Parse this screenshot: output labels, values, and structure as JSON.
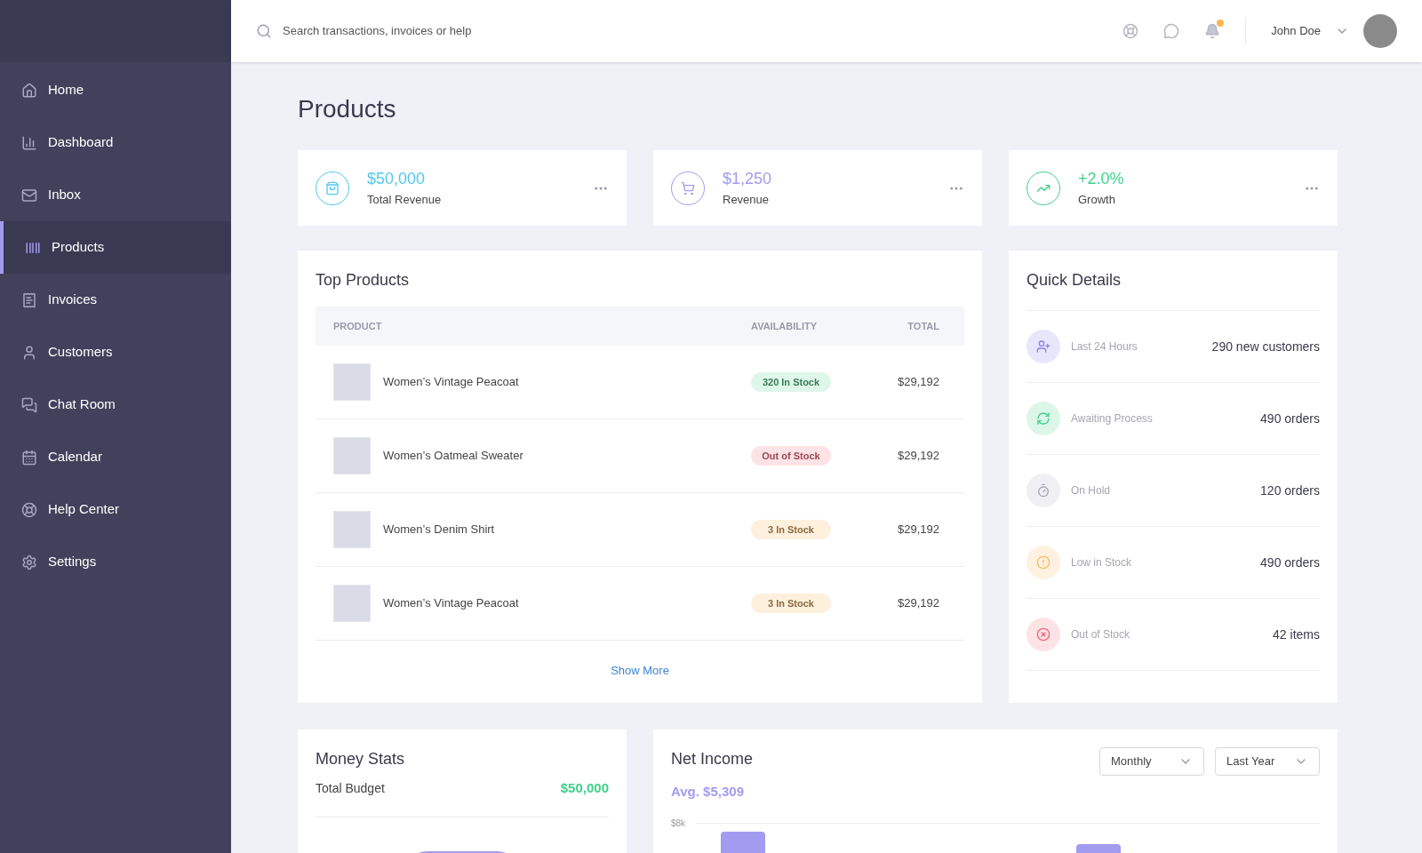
{
  "sidebar": {
    "items": [
      {
        "label": "Home",
        "kind": "home",
        "selected": false
      },
      {
        "label": "Dashboard",
        "kind": "chart",
        "selected": false
      },
      {
        "label": "Inbox",
        "kind": "mail",
        "selected": false
      },
      {
        "label": "Products",
        "kind": "barcode",
        "selected": true
      },
      {
        "label": "Invoices",
        "kind": "receipt",
        "selected": false
      },
      {
        "label": "Customers",
        "kind": "user",
        "selected": false
      },
      {
        "label": "Chat Room",
        "kind": "chat",
        "selected": false
      },
      {
        "label": "Calendar",
        "kind": "calendar",
        "selected": false
      },
      {
        "label": "Help Center",
        "kind": "help",
        "selected": false
      },
      {
        "label": "Settings",
        "kind": "gear",
        "selected": false
      }
    ]
  },
  "header": {
    "search": {
      "placeholder": "Search transactions, invoices or help"
    },
    "notification_dot": true,
    "user": {
      "name": "John Doe"
    }
  },
  "page_title": "Products",
  "stats": [
    {
      "value": "$50,000",
      "label": "Total Revenue",
      "kind": "bag",
      "color": "#4fc9ef"
    },
    {
      "value": "$1,250",
      "label": "Revenue",
      "kind": "cart",
      "color": "#a29bef"
    },
    {
      "value": "+2.0%",
      "label": "Growth",
      "kind": "trend",
      "color": "#3fd18c"
    }
  ],
  "top_products": {
    "title": "Top Products",
    "columns": [
      "PRODUCT",
      "AVAILABILITY",
      "TOTAL"
    ],
    "rows": [
      {
        "name": "Women’s Vintage Peacoat",
        "availability": "320 In Stock",
        "kind": "in",
        "total": "$29,192"
      },
      {
        "name": "Women’s Oatmeal Sweater",
        "availability": "Out of Stock",
        "kind": "out",
        "total": "$29,192"
      },
      {
        "name": "Women’s Denim Shirt",
        "availability": "3 In Stock",
        "kind": "low",
        "total": "$29,192"
      },
      {
        "name": "Women’s Vintage Peacoat",
        "availability": "3 In Stock",
        "kind": "low",
        "total": "$29,192"
      }
    ],
    "show_more": "Show More"
  },
  "quick_details": {
    "title": "Quick Details",
    "items": [
      {
        "label": "Last 24 Hours",
        "value": "290 new customers",
        "kind": "customers"
      },
      {
        "label": "Awaiting Process",
        "value": "490 orders",
        "kind": "process"
      },
      {
        "label": "On Hold",
        "value": "120 orders",
        "kind": "hold"
      },
      {
        "label": "Low in Stock",
        "value": "490 orders",
        "kind": "low"
      },
      {
        "label": "Out of Stock",
        "value": "42 items",
        "kind": "out"
      }
    ]
  },
  "money_stats": {
    "title": "Money Stats",
    "budget_label": "Total Budget",
    "budget_value": "$50,000"
  },
  "net_income": {
    "title": "Net Income",
    "average": "Avg. $5,309",
    "filters": [
      "Monthly",
      "Last Year"
    ],
    "y_tick": "$8k"
  }
}
